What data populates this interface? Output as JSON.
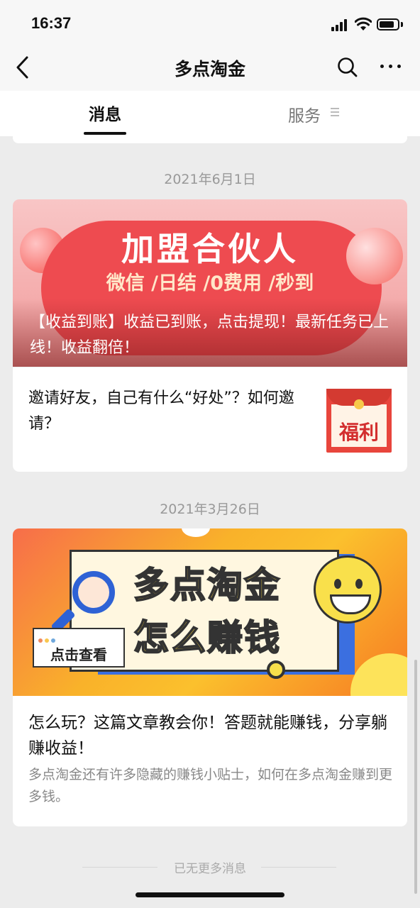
{
  "status_bar": {
    "time": "16:37"
  },
  "header": {
    "title": "多点淘金"
  },
  "tabs": {
    "messages": "消息",
    "services": "服务"
  },
  "groups": [
    {
      "date": "2021年6月1日",
      "banner": {
        "headline": "加盟合伙人",
        "subline": "微信 /日结 /0费用 /秒到",
        "overlay": "【收益到账】收益已到账，点击提现！最新任务已上线！收益翻倍！"
      },
      "item": {
        "text": "邀请好友，自己有什么“好处”？如何邀请？",
        "thumb_label": "福利"
      }
    },
    {
      "date": "2021年3月26日",
      "banner": {
        "line1": "多点淘金",
        "line2": "怎么赚钱",
        "button": "点击查看"
      },
      "title": "怎么玩？这篇文章教会你！答题就能赚钱，分享躺赚收益！",
      "desc": "多点淘金还有许多隐藏的赚钱小贴士，如何在多点淘金赚到更多钱。"
    }
  ],
  "footer": {
    "no_more": "已无更多消息"
  },
  "colors": {
    "accent_red": "#ee4b50",
    "banner_orange": "#f9b22a",
    "background": "#ececec"
  }
}
